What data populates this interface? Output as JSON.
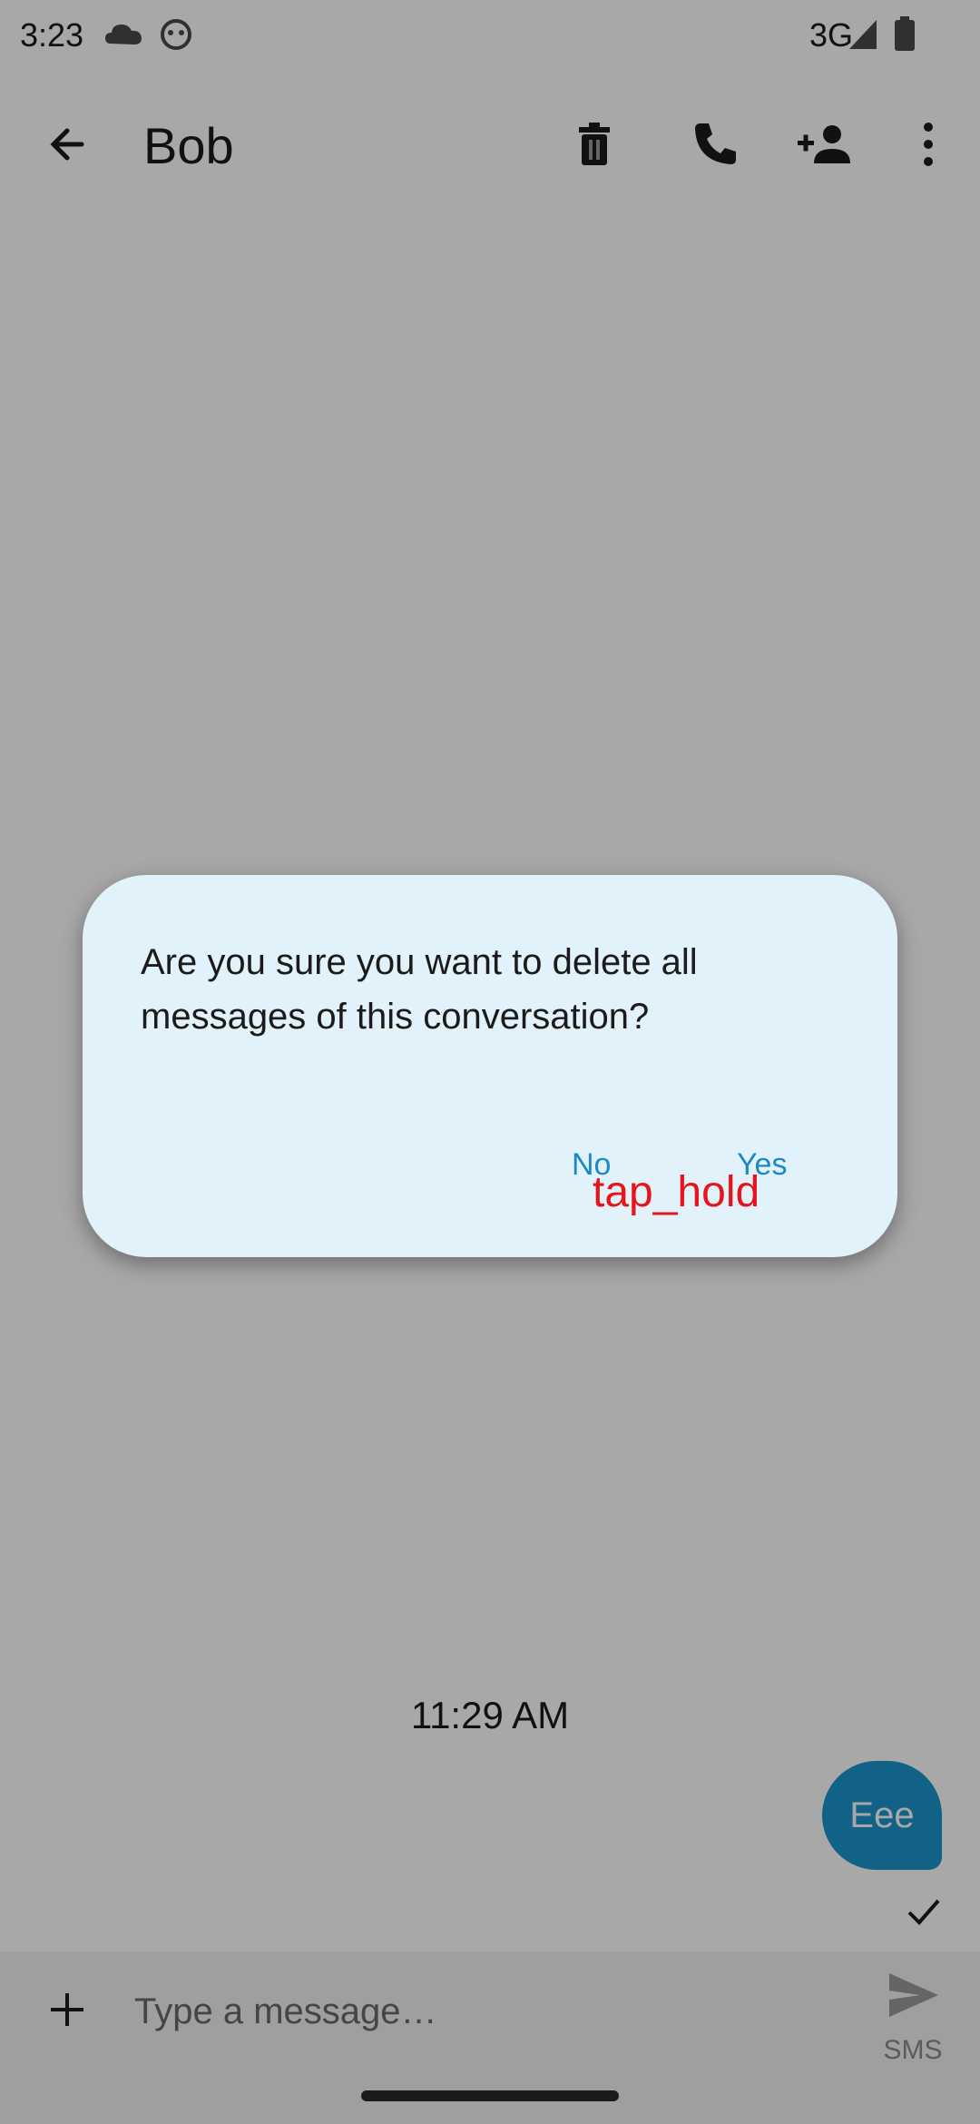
{
  "status_bar": {
    "time": "3:23",
    "network": "3G"
  },
  "toolbar": {
    "title": "Bob",
    "icons": [
      "back-arrow-icon",
      "delete-icon",
      "phone-icon",
      "add-person-icon",
      "more-vert-icon"
    ]
  },
  "conversation": {
    "timestamp": "11:29 AM",
    "messages": [
      {
        "text": "Eee",
        "status_icon": "check-icon"
      }
    ]
  },
  "composer": {
    "placeholder": "Type a message…",
    "send_label": "SMS"
  },
  "dialog": {
    "message": "Are you sure you want to delete all messages of this conversation?",
    "no_label": "No",
    "yes_label": "Yes"
  },
  "annotation": {
    "text": "tap_hold"
  },
  "colors": {
    "accent": "#1a95cb",
    "dialog_bg": "#e2f2fb",
    "annotation": "#e8141b"
  }
}
